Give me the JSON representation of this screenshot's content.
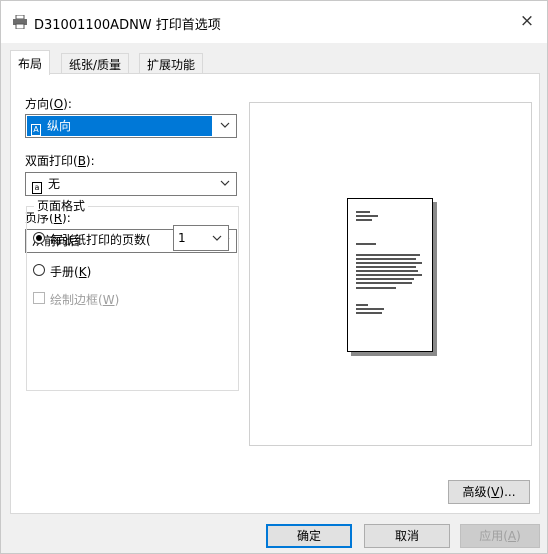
{
  "window": {
    "title": "D31001100ADNW 打印首选项",
    "close_glyph": "×"
  },
  "tabs": [
    {
      "label": "布局",
      "active": true
    },
    {
      "label": "纸张/质量",
      "active": false
    },
    {
      "label": "扩展功能",
      "active": false
    }
  ],
  "layout": {
    "orientation": {
      "label_prefix": "方向(",
      "accel": "O",
      "label_suffix": "):",
      "value": "纵向",
      "icon": "portrait-page-icon"
    },
    "duplex": {
      "label_prefix": "双面打印(",
      "accel": "B",
      "label_suffix": "):",
      "value": "无",
      "icon": "single-sided-icon"
    },
    "page_order": {
      "label_prefix": "页序(",
      "accel": "R",
      "label_suffix": "):",
      "value": "从前向后"
    },
    "page_format": {
      "title": "页面格式",
      "pages_per_sheet": {
        "label": "每张纸打印的页数(",
        "value": "1",
        "selected": true
      },
      "booklet": {
        "label_prefix": "手册(",
        "accel": "K",
        "label_suffix": ")",
        "selected": false
      },
      "draw_borders": {
        "label_prefix": "绘制边框(",
        "accel": "W",
        "label_suffix": ")",
        "checked": false,
        "enabled": false
      }
    }
  },
  "buttons": {
    "advanced": {
      "label_prefix": "高级(",
      "accel": "V",
      "label_suffix": ")..."
    },
    "ok": "确定",
    "cancel": "取消",
    "apply": {
      "label_prefix": "应用(",
      "accel": "A",
      "label_suffix": ")"
    }
  },
  "colors": {
    "accent": "#0078d7",
    "panel": "#ffffff",
    "chrome": "#f0f0f0"
  }
}
